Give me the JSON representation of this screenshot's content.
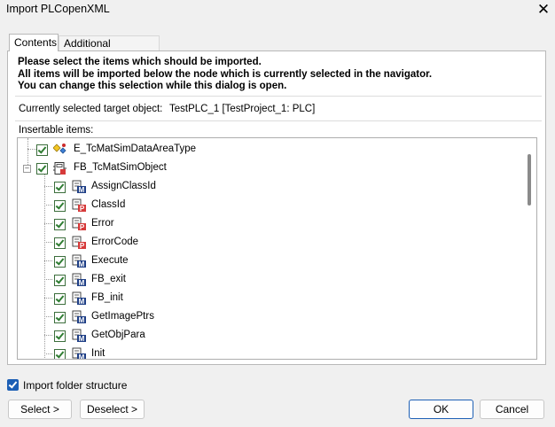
{
  "window": {
    "title": "Import PLCopenXML",
    "close_glyph": "✕"
  },
  "tabs": [
    {
      "label": "Contents",
      "active": true
    },
    {
      "label": "Additional information",
      "active": false
    }
  ],
  "instructions": [
    "Please select the items which should be imported.",
    "All items will be imported below the node which is currently selected in the navigator.",
    "You can change this selection while this dialog is open."
  ],
  "target": {
    "label": "Currently selected target object:",
    "value": "TestPLC_1 [TestProject_1: PLC]"
  },
  "insertable_label": "Insertable items:",
  "tree": {
    "root_items": [
      {
        "label": "E_TcMatSimDataAreaType",
        "icon": "enum-icon",
        "checked": true
      },
      {
        "label": "FB_TcMatSimObject",
        "icon": "function-block-icon",
        "checked": true,
        "expanded": true
      }
    ],
    "children": [
      {
        "label": "AssignClassId",
        "icon": "method-icon",
        "checked": true
      },
      {
        "label": "ClassId",
        "icon": "property-icon",
        "checked": true
      },
      {
        "label": "Error",
        "icon": "property-icon",
        "checked": true
      },
      {
        "label": "ErrorCode",
        "icon": "property-icon",
        "checked": true
      },
      {
        "label": "Execute",
        "icon": "method-icon",
        "checked": true
      },
      {
        "label": "FB_exit",
        "icon": "method-icon",
        "checked": true
      },
      {
        "label": "FB_init",
        "icon": "method-icon",
        "checked": true
      },
      {
        "label": "GetImagePtrs",
        "icon": "method-icon",
        "checked": true
      },
      {
        "label": "GetObjPara",
        "icon": "method-icon",
        "checked": true
      },
      {
        "label": "Init",
        "icon": "method-icon",
        "checked": true
      }
    ]
  },
  "import_folder": {
    "label": "Import folder structure",
    "checked": true
  },
  "buttons": {
    "select": "Select >",
    "deselect": "Deselect >",
    "ok": "OK",
    "cancel": "Cancel"
  },
  "colors": {
    "accent": "#1d5fb5",
    "check": "#2f7d32"
  }
}
